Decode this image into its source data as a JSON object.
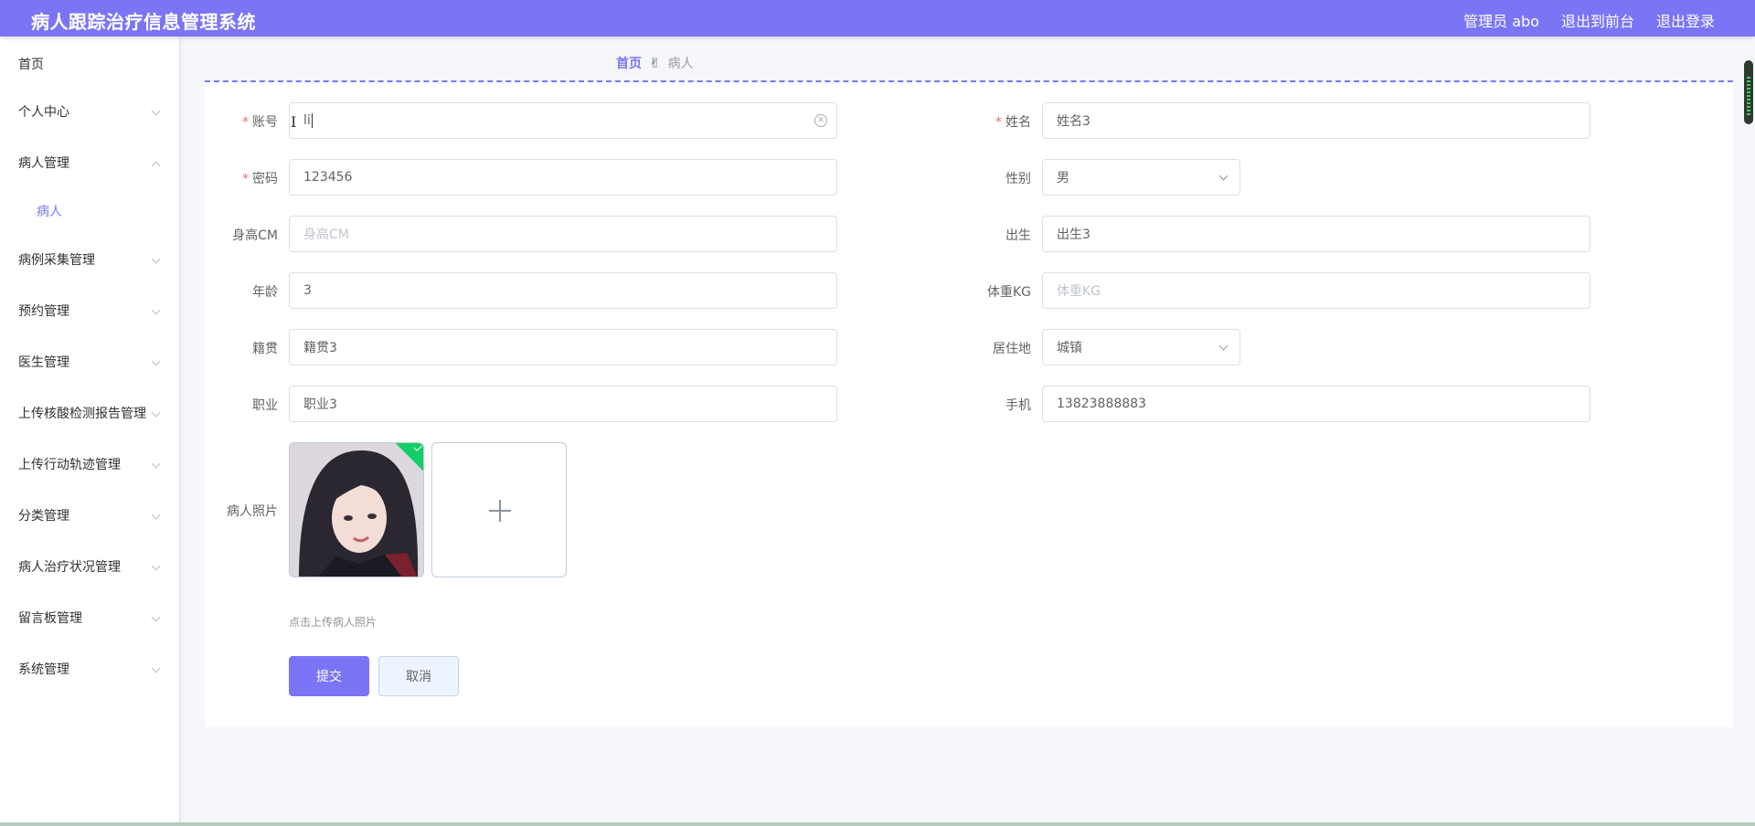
{
  "header": {
    "title": "病人跟踪治疗信息管理系统",
    "user": "管理员 abo",
    "to_front": "退出到前台",
    "logout": "退出登录",
    "bg_color": "#7b75f6"
  },
  "sidebar": {
    "items": [
      {
        "label": "首页"
      },
      {
        "label": "个人中心"
      },
      {
        "label": "病人管理"
      },
      {
        "label": "病人"
      },
      {
        "label": "病例采集管理"
      },
      {
        "label": "预约管理"
      },
      {
        "label": "医生管理"
      },
      {
        "label": "上传核酸检测报告管理"
      },
      {
        "label": "上传行动轨迹管理"
      },
      {
        "label": "分类管理"
      },
      {
        "label": "病人治疗状况管理"
      },
      {
        "label": "留言板管理"
      },
      {
        "label": "系统管理"
      }
    ]
  },
  "breadcrumb": {
    "home": "首页",
    "separator": "✌",
    "current": "病人"
  },
  "form": {
    "account": {
      "label": "账号",
      "value": "li",
      "required_mark": "*"
    },
    "name": {
      "label": "姓名",
      "value": "姓名3",
      "required_mark": "*"
    },
    "password": {
      "label": "密码",
      "value": "123456",
      "required_mark": "*"
    },
    "gender": {
      "label": "性别",
      "value": "男"
    },
    "height": {
      "label": "身高CM",
      "placeholder": "身高CM"
    },
    "birth": {
      "label": "出生",
      "value": "出生3"
    },
    "age": {
      "label": "年龄",
      "value": "3"
    },
    "weight": {
      "label": "体重KG",
      "placeholder": "体重KG"
    },
    "hometown": {
      "label": "籍贯",
      "value": "籍贯3"
    },
    "residence": {
      "label": "居住地",
      "value": "城镇"
    },
    "job": {
      "label": "职业",
      "value": "职业3"
    },
    "phone": {
      "label": "手机",
      "value": "13823888883"
    },
    "photo": {
      "label": "病人照片",
      "tip": "点击上传病人照片"
    },
    "submit": "提交",
    "cancel": "取消"
  }
}
